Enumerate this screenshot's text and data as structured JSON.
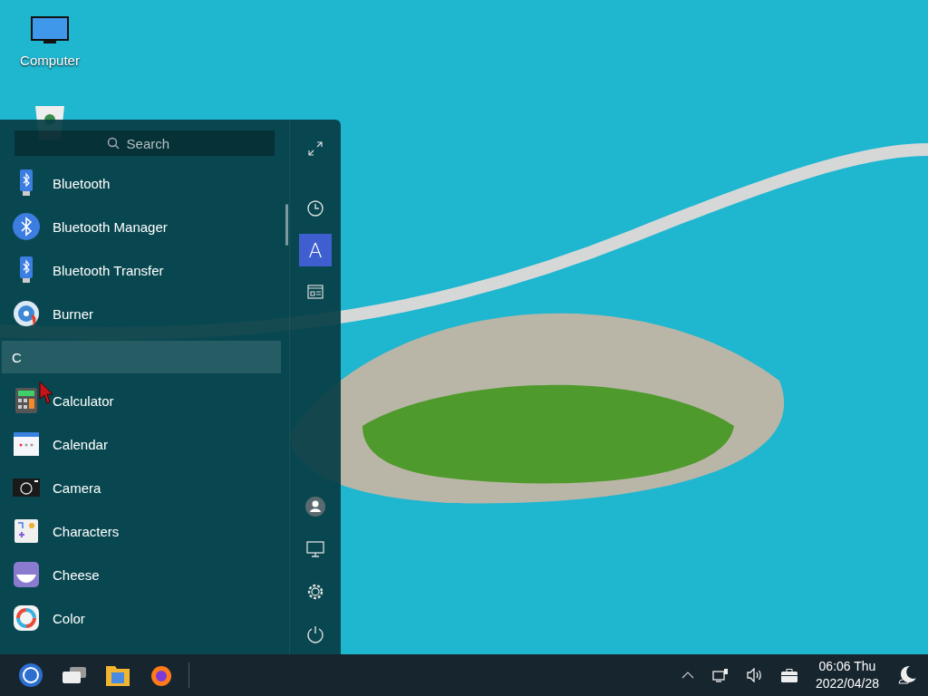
{
  "desktop_icons": [
    {
      "label": "Computer",
      "kind": "computer"
    },
    {
      "kind": "trash"
    }
  ],
  "start_menu": {
    "search": {
      "placeholder": "Search"
    },
    "entries": [
      {
        "kind": "app",
        "label": "Bluetooth"
      },
      {
        "kind": "app",
        "label": "Bluetooth Manager"
      },
      {
        "kind": "app",
        "label": "Bluetooth Transfer"
      },
      {
        "kind": "app",
        "label": "Burner"
      },
      {
        "kind": "letter",
        "label": "C"
      },
      {
        "kind": "app",
        "label": "Calculator"
      },
      {
        "kind": "app",
        "label": "Calendar"
      },
      {
        "kind": "app",
        "label": "Camera"
      },
      {
        "kind": "app",
        "label": "Characters"
      },
      {
        "kind": "app",
        "label": "Cheese"
      },
      {
        "kind": "app",
        "label": "Color"
      }
    ],
    "view_buttons": [
      {
        "kind": "expand"
      },
      {
        "kind": "recent",
        "selected": false
      },
      {
        "kind": "letter",
        "label": "A",
        "selected": true
      },
      {
        "kind": "category",
        "selected": false
      }
    ],
    "action_buttons": [
      {
        "kind": "user"
      },
      {
        "kind": "computer"
      },
      {
        "kind": "settings"
      },
      {
        "kind": "power"
      }
    ]
  },
  "taskbar": {
    "apps": [
      {
        "kind": "start"
      },
      {
        "kind": "tasks"
      },
      {
        "kind": "files"
      },
      {
        "kind": "browser"
      }
    ],
    "clock": {
      "time": "06:06 Thu",
      "date": "2022/04/28"
    }
  }
}
